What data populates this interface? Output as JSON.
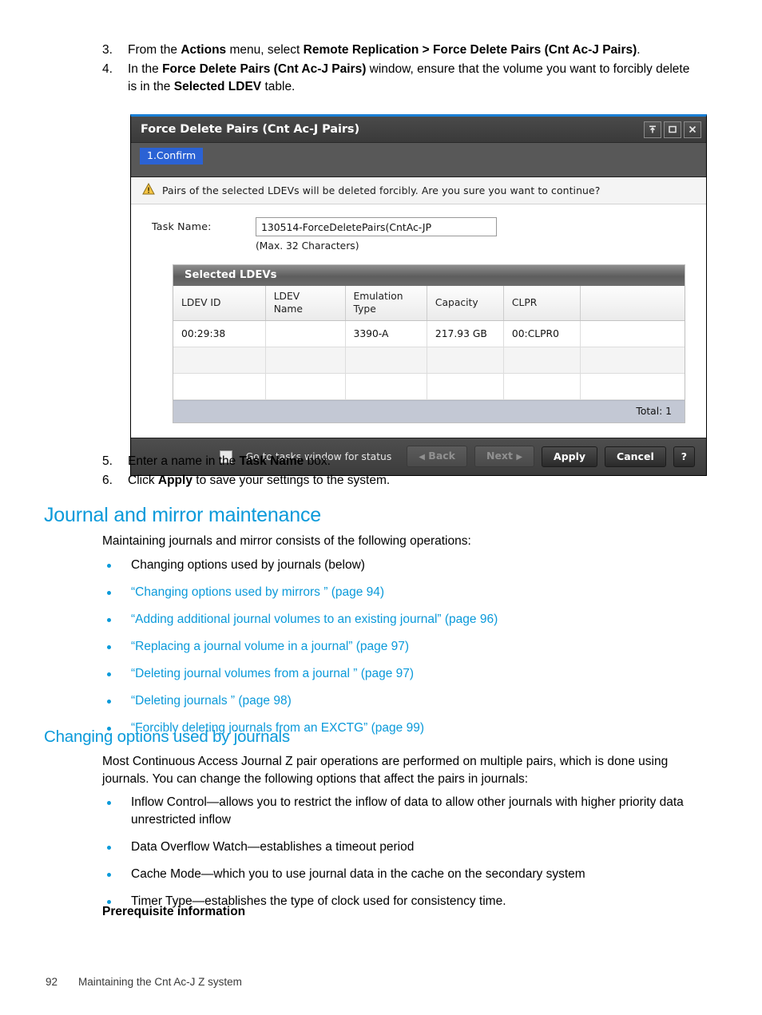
{
  "steps_top": [
    {
      "num": "3.",
      "parts": [
        {
          "t": "From the ",
          "b": false
        },
        {
          "t": "Actions",
          "b": true
        },
        {
          "t": " menu, select ",
          "b": false
        },
        {
          "t": "Remote Replication > Force Delete Pairs (Cnt Ac-J Pairs)",
          "b": true
        },
        {
          "t": ".",
          "b": false
        }
      ]
    },
    {
      "num": "4.",
      "parts": [
        {
          "t": "In the ",
          "b": false
        },
        {
          "t": "Force Delete Pairs (Cnt Ac-J Pairs)",
          "b": true
        },
        {
          "t": " window, ensure that the volume you want to forcibly delete is in the ",
          "b": false
        },
        {
          "t": "Selected LDEV",
          "b": true
        },
        {
          "t": " table.",
          "b": false
        }
      ]
    }
  ],
  "dialog": {
    "title": "Force Delete Pairs (Cnt Ac-J Pairs)",
    "window_buttons": [
      "collapse-icon",
      "maximize-icon",
      "close-icon"
    ],
    "tab": "1.Confirm",
    "warning_icon": "warning-triangle-icon",
    "warning_text": "Pairs of the selected LDEVs will be deleted forcibly. Are you sure you want to continue?",
    "task_name_label": "Task Name:",
    "task_name_value": "130514-ForceDeletePairs(CntAc-JP",
    "task_name_hint": "(Max. 32 Characters)",
    "table": {
      "caption": "Selected LDEVs",
      "columns": [
        "LDEV ID",
        "LDEV\nName",
        "Emulation\nType",
        "Capacity",
        "CLPR",
        ""
      ],
      "columns_display": [
        {
          "line1": "LDEV ID",
          "line2": ""
        },
        {
          "line1": "LDEV",
          "line2": "Name"
        },
        {
          "line1": "Emulation",
          "line2": "Type"
        },
        {
          "line1": "Capacity",
          "line2": ""
        },
        {
          "line1": "CLPR",
          "line2": ""
        },
        {
          "line1": "",
          "line2": ""
        }
      ],
      "rows": [
        [
          "00:29:38",
          "",
          "3390-A",
          "217.93 GB",
          "00:CLPR0",
          ""
        ],
        [
          "",
          "",
          "",
          "",
          "",
          ""
        ],
        [
          "",
          "",
          "",
          "",
          "",
          ""
        ]
      ],
      "total_label": "Total:  1"
    },
    "footer": {
      "checkbox_label": "Go to tasks window for status",
      "back_label": "Back",
      "next_label": "Next",
      "apply_label": "Apply",
      "cancel_label": "Cancel",
      "help_label": "?"
    },
    "accent_color": "#1a7fd4",
    "tab_color": "#2b62d4"
  },
  "steps_bottom": [
    {
      "num": "5.",
      "parts": [
        {
          "t": "Enter a name in the ",
          "b": false
        },
        {
          "t": "Task Name",
          "b": true
        },
        {
          "t": " box.",
          "b": false
        }
      ]
    },
    {
      "num": "6.",
      "parts": [
        {
          "t": "Click ",
          "b": false
        },
        {
          "t": "Apply",
          "b": true
        },
        {
          "t": " to save your settings to the system.",
          "b": false
        }
      ]
    }
  ],
  "section_journal": {
    "heading": "Journal and mirror maintenance",
    "intro": "Maintaining journals and mirror consists of the following operations:",
    "bullets": [
      {
        "text": "Changing options used by journals (below)",
        "link": false
      },
      {
        "text": "“Changing options used by mirrors ” (page 94)",
        "link": true
      },
      {
        "text": "“Adding additional journal volumes to an existing journal” (page 96)",
        "link": true
      },
      {
        "text": "“Replacing a journal volume in a journal” (page 97)",
        "link": true
      },
      {
        "text": "“Deleting journal volumes from a journal ” (page 97)",
        "link": true
      },
      {
        "text": "“Deleting journals ” (page 98)",
        "link": true
      },
      {
        "text": "“Forcibly deleting journals from an EXCTG” (page 99)",
        "link": true
      }
    ]
  },
  "section_changing": {
    "heading": "Changing options used by journals",
    "intro": "Most Continuous Access Journal Z pair operations are performed on multiple pairs, which is done using journals. You can change the following options that affect the pairs in journals:",
    "bullets": [
      "Inflow Control—allows you to restrict the inflow of data to allow other journals with higher priority data unrestricted inflow",
      "Data Overflow Watch—establishes a timeout period",
      "Cache Mode—which you to use journal data in the cache on the secondary system",
      "Timer Type—establishes the type of clock used for consistency time."
    ],
    "prereq_heading": "Prerequisite information"
  },
  "page_footer": {
    "page_number": "92",
    "chapter": "Maintaining the Cnt Ac-J Z system"
  },
  "colors": {
    "heading_blue": "#0b9ada",
    "link_blue": "#0b9ada",
    "bullet_blue": "#0b9ada"
  }
}
